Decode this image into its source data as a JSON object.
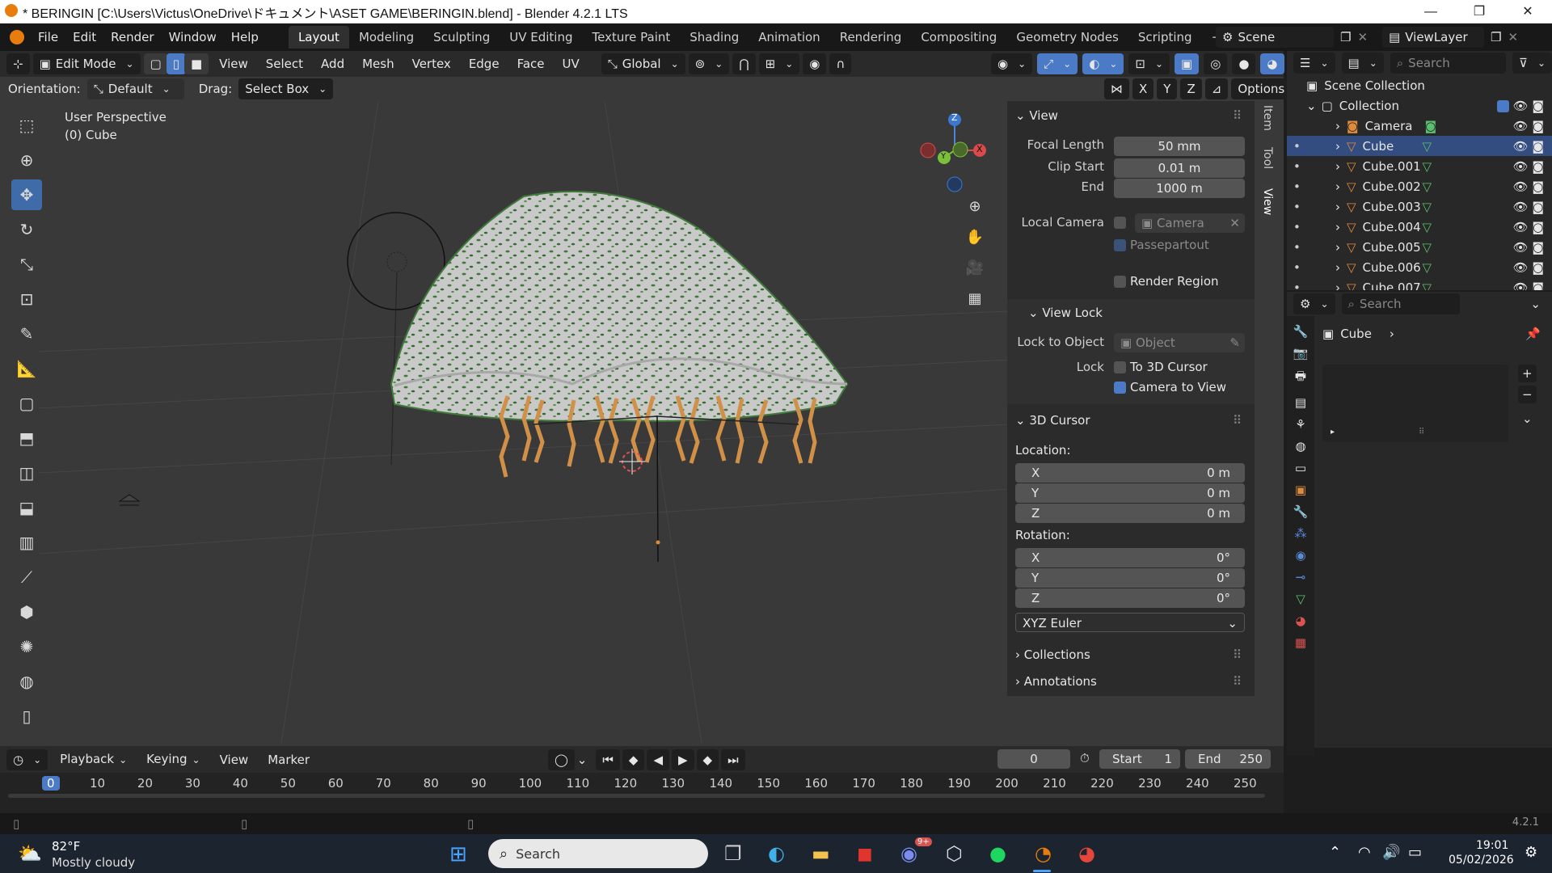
{
  "window": {
    "title": "* BERINGIN [C:\\Users\\Victus\\OneDrive\\ドキュメント\\ASET GAME\\BERINGIN.blend] - Blender 4.2.1 LTS",
    "controls": [
      "—",
      "❐",
      "✕"
    ]
  },
  "menubar": {
    "items": [
      "File",
      "Edit",
      "Render",
      "Window",
      "Help"
    ],
    "workspaces": [
      "Layout",
      "Modeling",
      "Sculpting",
      "UV Editing",
      "Texture Paint",
      "Shading",
      "Animation",
      "Rendering",
      "Compositing",
      "Geometry Nodes",
      "Scripting"
    ],
    "active_workspace": "Layout",
    "add_tab": "+",
    "scene": "Scene",
    "view_layer": "ViewLayer"
  },
  "viewport_header": {
    "mode": "Edit Mode",
    "menus": [
      "View",
      "Select",
      "Add",
      "Mesh",
      "Vertex",
      "Edge",
      "Face",
      "UV"
    ],
    "transform": "Global",
    "orientation_label": "Orientation:",
    "orientation_value": "Default",
    "drag_label": "Drag:",
    "drag_value": "Select Box",
    "axes": [
      "X",
      "Y",
      "Z"
    ],
    "options": "Options"
  },
  "viewport": {
    "perspective": "User Perspective",
    "object": "(0) Cube",
    "gizmo": {
      "z": "Z",
      "y": "Y",
      "x": "X"
    }
  },
  "sidebar_tabs": [
    "Item",
    "Tool",
    "View"
  ],
  "view_panel": {
    "title": "View",
    "focal_length_label": "Focal Length",
    "focal_length": "50 mm",
    "clip_start_label": "Clip Start",
    "clip_start": "0.01 m",
    "end_label": "End",
    "end": "1000 m",
    "local_camera_label": "Local Camera",
    "local_camera": "Camera",
    "passepartout": "Passepartout",
    "render_region": "Render Region",
    "view_lock_title": "View Lock",
    "lock_to_object_label": "Lock to Object",
    "lock_to_object_placeholder": "Object",
    "lock_label": "Lock",
    "to_3d_cursor": "To 3D Cursor",
    "camera_to_view": "Camera to View",
    "cursor_title": "3D Cursor",
    "location_label": "Location:",
    "loc_x": "0 m",
    "loc_y": "0 m",
    "loc_z": "0 m",
    "rotation_label": "Rotation:",
    "rot_x": "0°",
    "rot_y": "0°",
    "rot_z": "0°",
    "rotation_mode": "XYZ Euler",
    "axis_x": "X",
    "axis_y": "Y",
    "axis_z": "Z",
    "collections": "Collections",
    "annotations": "Annotations"
  },
  "outliner": {
    "search_placeholder": "Search",
    "scene_collection": "Scene Collection",
    "collection": "Collection",
    "items": [
      "Camera",
      "Cube",
      "Cube.001",
      "Cube.002",
      "Cube.003",
      "Cube.004",
      "Cube.005",
      "Cube.006",
      "Cube.007"
    ],
    "selected": "Cube"
  },
  "properties": {
    "search_placeholder": "Search",
    "breadcrumb": "Cube"
  },
  "timeline": {
    "menus": [
      "Playback",
      "Keying",
      "View",
      "Marker"
    ],
    "current_frame": "0",
    "start_label": "Start",
    "start": "1",
    "end_label": "End",
    "end": "250",
    "ticks": [
      "0",
      "10",
      "20",
      "30",
      "40",
      "50",
      "60",
      "70",
      "80",
      "90",
      "100",
      "110",
      "120",
      "130",
      "140",
      "150",
      "160",
      "170",
      "180",
      "190",
      "200",
      "210",
      "220",
      "230",
      "240",
      "250"
    ]
  },
  "statusbar": {
    "version": "4.2.1"
  },
  "taskbar": {
    "weather_temp": "82°F",
    "weather_desc": "Mostly cloudy",
    "search_placeholder": "Search",
    "discord_badge": "9+",
    "time": "19:01",
    "date": "05/02/2026"
  },
  "colors": {
    "accent": "#4b7bc7",
    "selection": "#334d80",
    "object_orange": "#e08a3c",
    "mesh_green": "#5bbf70"
  }
}
